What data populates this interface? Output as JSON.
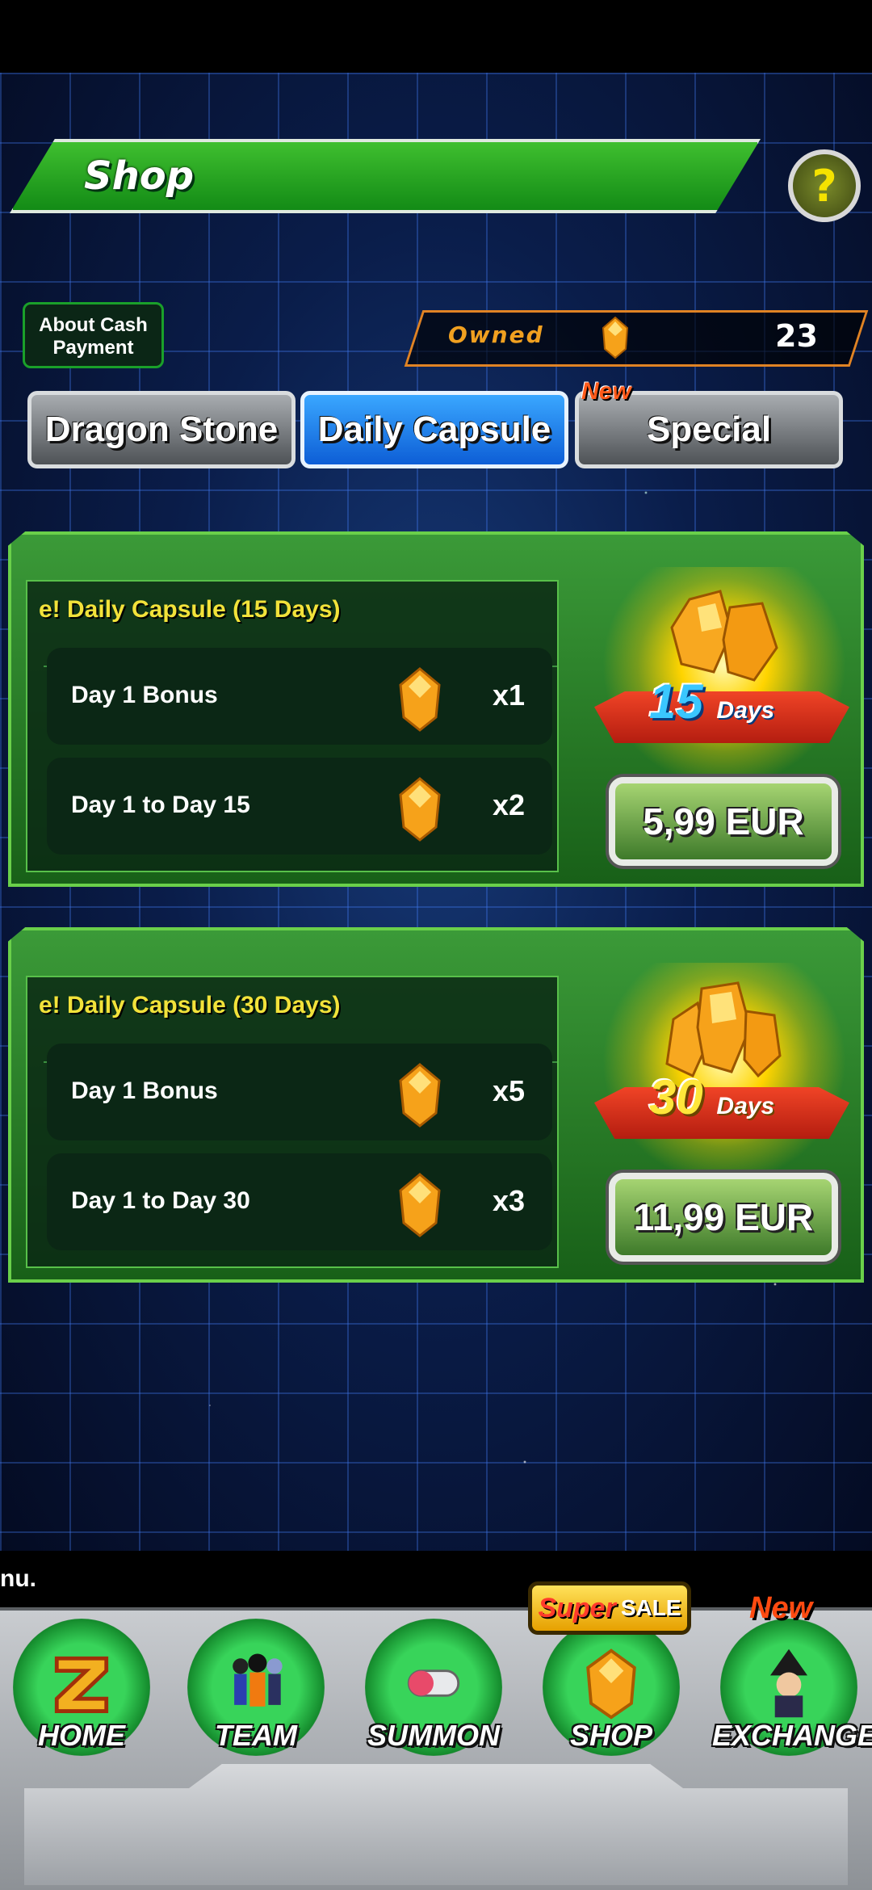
{
  "header": {
    "title": "Shop",
    "help_label": "?"
  },
  "cash_button": {
    "line1": "About Cash",
    "line2": "Payment"
  },
  "owned": {
    "label": "Owned",
    "value": "23"
  },
  "tabs": [
    {
      "label": "Dragon Stone",
      "active": false
    },
    {
      "label": "Daily Capsule",
      "active": true
    },
    {
      "label": "Special",
      "active": false,
      "badge": "New"
    }
  ],
  "offers": [
    {
      "title": "e! Daily Capsule (15 Days)",
      "rows": [
        {
          "label": "Day 1 Bonus",
          "qty": "x1"
        },
        {
          "label": "Day 1 to Day 15",
          "qty": "x2"
        }
      ],
      "days_num": "15",
      "days_word": "Days",
      "price": "5,99 EUR"
    },
    {
      "title": "e! Daily Capsule (30 Days)",
      "rows": [
        {
          "label": "Day 1 Bonus",
          "qty": "x5"
        },
        {
          "label": "Day 1 to Day 30",
          "qty": "x3"
        }
      ],
      "days_num": "30",
      "days_word": "Days",
      "price": "11,99 EUR"
    }
  ],
  "ticker": {
    "text": "nu."
  },
  "nav": {
    "items": [
      {
        "label": "HOME"
      },
      {
        "label": "TEAM"
      },
      {
        "label": "SUMMON"
      },
      {
        "label": "SHOP"
      },
      {
        "label": "EXCHANGE"
      }
    ],
    "super_sale": {
      "super": "Super",
      "sale": "SALE"
    },
    "exchange_badge": "New"
  },
  "colors": {
    "accent_green": "#2e9a2a",
    "tab_active": "#1a7ef0",
    "gem_orange": "#f6a21a"
  }
}
